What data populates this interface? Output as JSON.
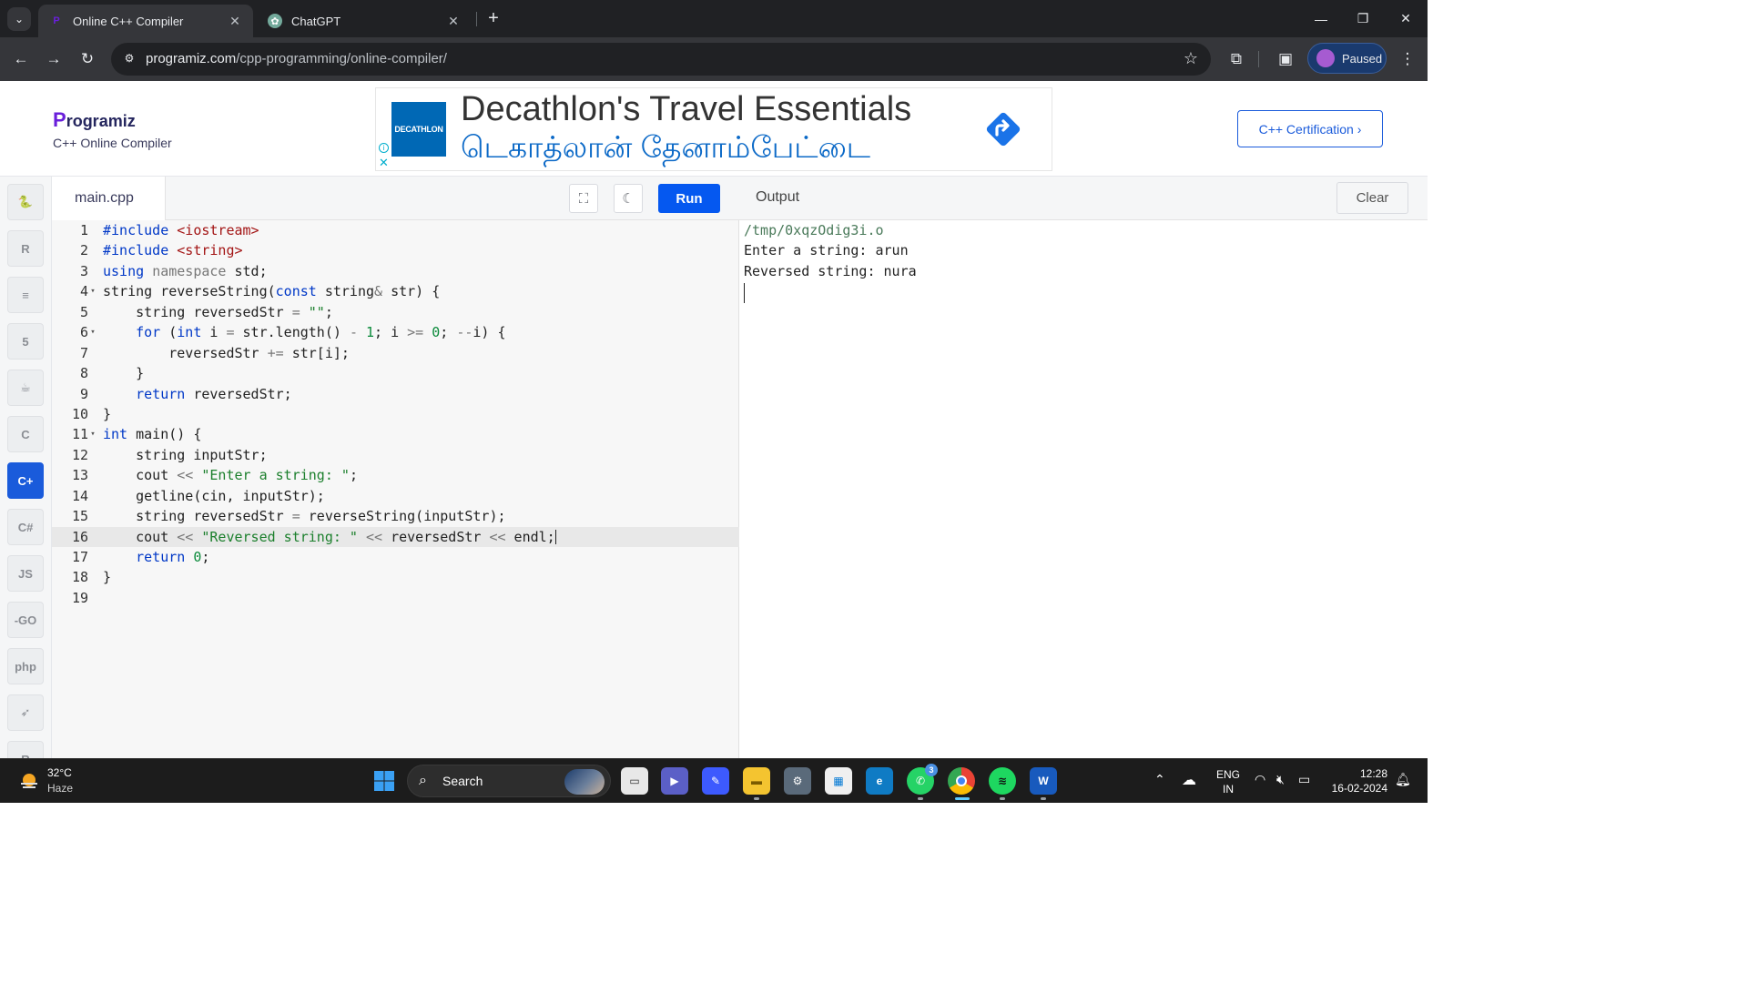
{
  "browser": {
    "tabs": [
      {
        "title": "Online C++ Compiler",
        "active": true
      },
      {
        "title": "ChatGPT",
        "active": false
      }
    ],
    "url_host": "programiz.com",
    "url_path": "/cpp-programming/online-compiler/",
    "profile_label": "Paused"
  },
  "site": {
    "logo_mark": "P",
    "logo_rest": "rogramiz",
    "subtitle": "C++ Online Compiler",
    "certification_button": "C++ Certification ›"
  },
  "ad": {
    "brand": "DECATHLON",
    "headline": "Decathlon's Travel Essentials",
    "subline": "டெகாத்லான் தேனாம்பேட்டை",
    "info_glyph": "i",
    "close_glyph": "✕"
  },
  "rail": {
    "items": [
      {
        "name": "python",
        "glyph": "🐍"
      },
      {
        "name": "r",
        "glyph": "R"
      },
      {
        "name": "sql",
        "glyph": "≡"
      },
      {
        "name": "html",
        "glyph": "5"
      },
      {
        "name": "java",
        "glyph": "☕"
      },
      {
        "name": "c",
        "glyph": "C"
      },
      {
        "name": "cpp",
        "glyph": "C+",
        "active": true
      },
      {
        "name": "csharp",
        "glyph": "C#"
      },
      {
        "name": "js",
        "glyph": "JS"
      },
      {
        "name": "go",
        "glyph": "-GO"
      },
      {
        "name": "php",
        "glyph": "php"
      },
      {
        "name": "swift",
        "glyph": "➶"
      },
      {
        "name": "rust",
        "glyph": "R"
      }
    ]
  },
  "editor": {
    "file_name": "main.cpp",
    "run_label": "Run",
    "lines": [
      {
        "n": "1",
        "fold": "",
        "code": [
          {
            "t": "#include ",
            "c": "k"
          },
          {
            "t": "<iostream>",
            "c": "inc"
          }
        ]
      },
      {
        "n": "2",
        "fold": "",
        "code": [
          {
            "t": "#include ",
            "c": "k"
          },
          {
            "t": "<string>",
            "c": "inc"
          }
        ]
      },
      {
        "n": "3",
        "fold": "",
        "code": [
          {
            "t": "using ",
            "c": "k"
          },
          {
            "t": "namespace ",
            "c": "g"
          },
          {
            "t": "std;",
            "c": ""
          }
        ]
      },
      {
        "n": "4",
        "fold": "▾",
        "code": [
          {
            "t": "string reverseString(",
            "c": ""
          },
          {
            "t": "const ",
            "c": "k"
          },
          {
            "t": "string",
            "c": ""
          },
          {
            "t": "&",
            "c": "o"
          },
          {
            "t": " str) {",
            "c": ""
          }
        ]
      },
      {
        "n": "5",
        "fold": "",
        "code": [
          {
            "t": "    string reversedStr ",
            "c": ""
          },
          {
            "t": "=",
            "c": "o"
          },
          {
            "t": " ",
            "c": ""
          },
          {
            "t": "\"\"",
            "c": "s"
          },
          {
            "t": ";",
            "c": ""
          }
        ]
      },
      {
        "n": "6",
        "fold": "▾",
        "code": [
          {
            "t": "    ",
            "c": ""
          },
          {
            "t": "for",
            "c": "k"
          },
          {
            "t": " (",
            "c": ""
          },
          {
            "t": "int",
            "c": "k"
          },
          {
            "t": " i ",
            "c": ""
          },
          {
            "t": "=",
            "c": "o"
          },
          {
            "t": " str.length() ",
            "c": ""
          },
          {
            "t": "-",
            "c": "o"
          },
          {
            "t": " ",
            "c": ""
          },
          {
            "t": "1",
            "c": "n"
          },
          {
            "t": "; i ",
            "c": ""
          },
          {
            "t": ">=",
            "c": "o"
          },
          {
            "t": " ",
            "c": ""
          },
          {
            "t": "0",
            "c": "n"
          },
          {
            "t": "; ",
            "c": ""
          },
          {
            "t": "--",
            "c": "o"
          },
          {
            "t": "i) {",
            "c": ""
          }
        ]
      },
      {
        "n": "7",
        "fold": "",
        "code": [
          {
            "t": "        reversedStr ",
            "c": ""
          },
          {
            "t": "+=",
            "c": "o"
          },
          {
            "t": " str[i];",
            "c": ""
          }
        ]
      },
      {
        "n": "8",
        "fold": "",
        "code": [
          {
            "t": "    }",
            "c": ""
          }
        ]
      },
      {
        "n": "9",
        "fold": "",
        "code": [
          {
            "t": "    ",
            "c": ""
          },
          {
            "t": "return",
            "c": "k"
          },
          {
            "t": " reversedStr;",
            "c": ""
          }
        ]
      },
      {
        "n": "10",
        "fold": "",
        "code": [
          {
            "t": "}",
            "c": ""
          }
        ]
      },
      {
        "n": "11",
        "fold": "▾",
        "code": [
          {
            "t": "int",
            "c": "k"
          },
          {
            "t": " main() {",
            "c": ""
          }
        ]
      },
      {
        "n": "12",
        "fold": "",
        "code": [
          {
            "t": "    string inputStr;",
            "c": ""
          }
        ]
      },
      {
        "n": "13",
        "fold": "",
        "code": [
          {
            "t": "    cout ",
            "c": ""
          },
          {
            "t": "<<",
            "c": "o"
          },
          {
            "t": " ",
            "c": ""
          },
          {
            "t": "\"Enter a string: \"",
            "c": "s"
          },
          {
            "t": ";",
            "c": ""
          }
        ]
      },
      {
        "n": "14",
        "fold": "",
        "code": [
          {
            "t": "    getline(cin, inputStr);",
            "c": ""
          }
        ]
      },
      {
        "n": "15",
        "fold": "",
        "code": [
          {
            "t": "    string reversedStr ",
            "c": ""
          },
          {
            "t": "=",
            "c": "o"
          },
          {
            "t": " reverseString(inputStr);",
            "c": ""
          }
        ]
      },
      {
        "n": "16",
        "fold": "",
        "hl": true,
        "code": [
          {
            "t": "    cout ",
            "c": ""
          },
          {
            "t": "<<",
            "c": "o"
          },
          {
            "t": " ",
            "c": ""
          },
          {
            "t": "\"Reversed string: \"",
            "c": "s"
          },
          {
            "t": " ",
            "c": ""
          },
          {
            "t": "<<",
            "c": "o"
          },
          {
            "t": " reversedStr ",
            "c": ""
          },
          {
            "t": "<<",
            "c": "o"
          },
          {
            "t": " endl;",
            "c": ""
          }
        ]
      },
      {
        "n": "17",
        "fold": "",
        "code": [
          {
            "t": "    ",
            "c": ""
          },
          {
            "t": "return",
            "c": "k"
          },
          {
            "t": " ",
            "c": ""
          },
          {
            "t": "0",
            "c": "n"
          },
          {
            "t": ";",
            "c": ""
          }
        ]
      },
      {
        "n": "18",
        "fold": "",
        "code": [
          {
            "t": "}",
            "c": ""
          }
        ]
      },
      {
        "n": "19",
        "fold": "",
        "code": []
      }
    ]
  },
  "output": {
    "title": "Output",
    "clear_label": "Clear",
    "lines": [
      "/tmp/0xqzOdig3i.o",
      "Enter a string: arun",
      "Reversed string: nura"
    ]
  },
  "taskbar": {
    "temperature": "32°C",
    "condition": "Haze",
    "search_label": "Search",
    "whatsapp_badge": "3",
    "language_line1": "ENG",
    "language_line2": "IN",
    "time": "12:28",
    "date": "16-02-2024"
  },
  "colors": {
    "accent": "#0558f0",
    "brand": "#6a1fdb",
    "chrome_dark": "#202124",
    "ad_blue": "#0068b5"
  }
}
